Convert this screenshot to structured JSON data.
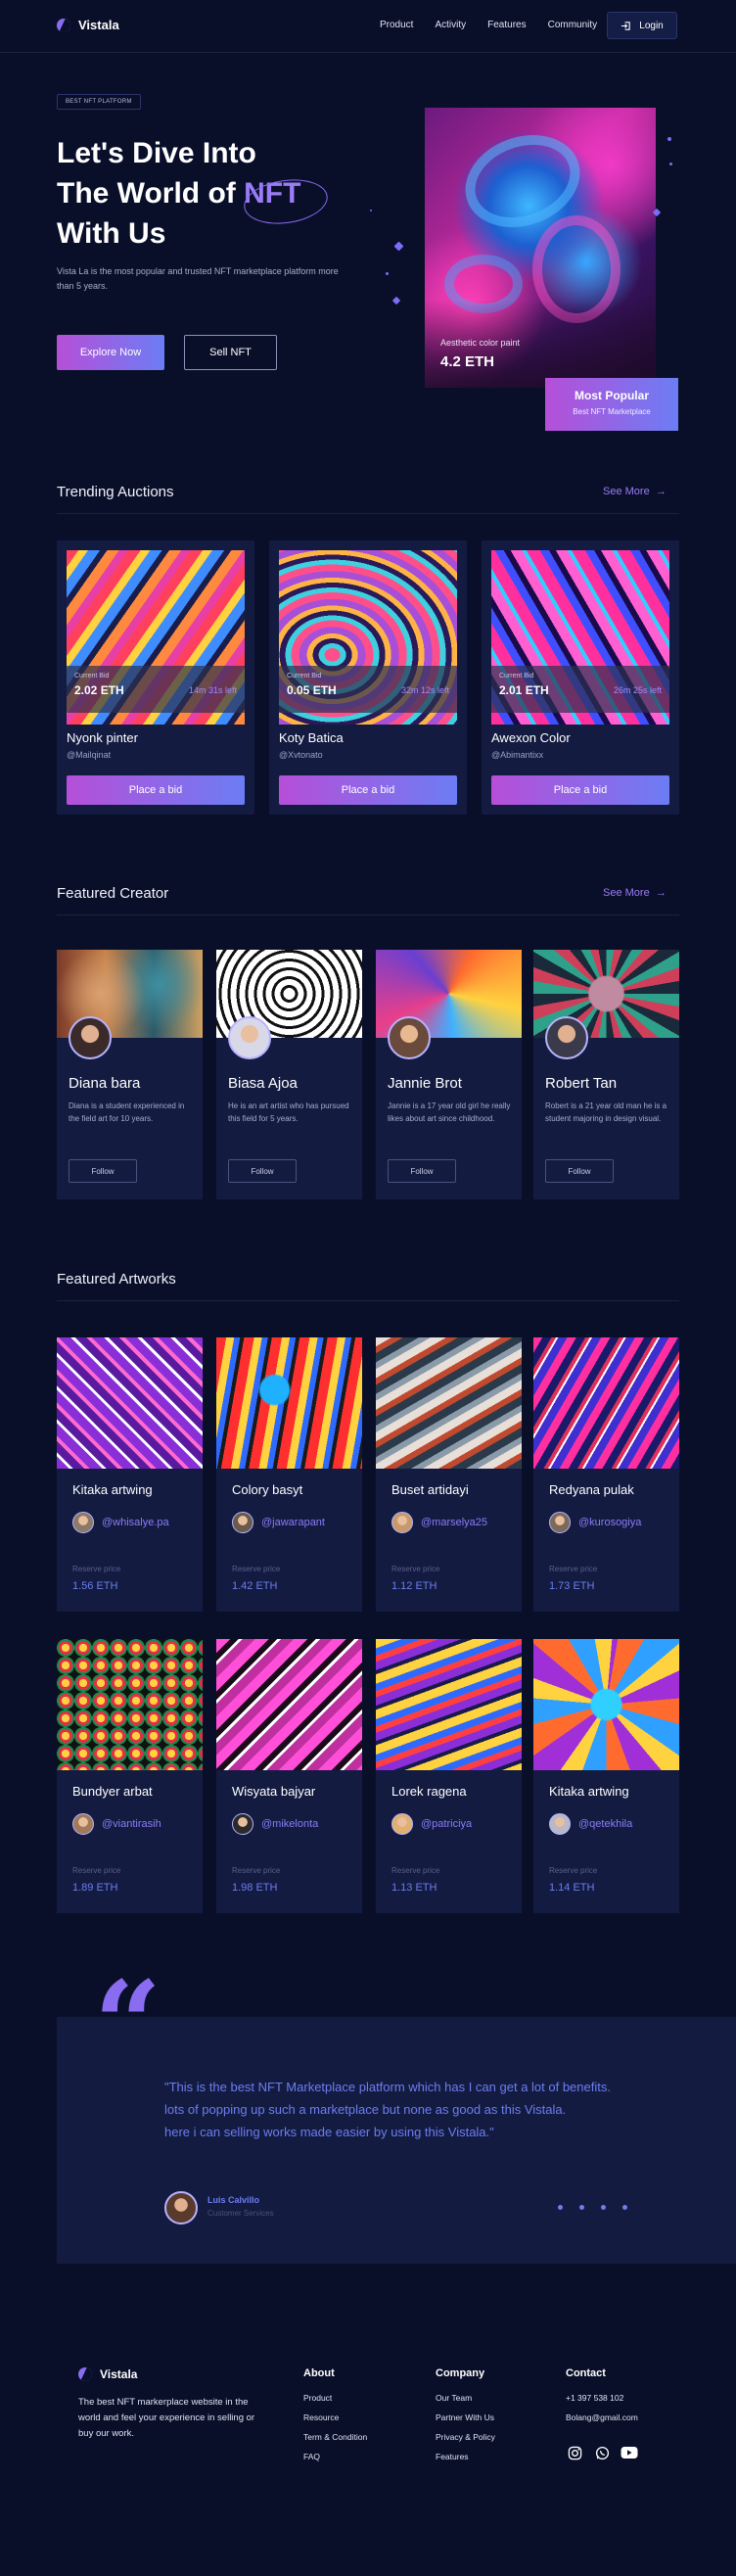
{
  "brand": {
    "name": "Vistala"
  },
  "nav": {
    "links": [
      "Product",
      "Activity",
      "Features",
      "Community"
    ],
    "login_label": "Login"
  },
  "hero": {
    "tag": "BEST NFT PLATFORM",
    "title_line1": "Let's Dive Into",
    "title_line2_pre": "The World of ",
    "title_highlight": "NFT",
    "title_line3": "With Us",
    "description": "Vista La is the most popular and trusted NFT marketplace platform more than 5 years.",
    "explore_label": "Explore Now",
    "sell_label": "Sell NFT",
    "art_label": "Aesthetic color paint",
    "art_price": "4.2 ETH",
    "popular_title": "Most Popular",
    "popular_sub": "Best NFT Marketplace"
  },
  "trending": {
    "title": "Trending Auctions",
    "see_more": "See More",
    "items": [
      {
        "bid_label": "Current Bid",
        "bid": "2.02 ETH",
        "time": "14m 31s left",
        "name": "Nyonk pinter",
        "user": "@Mailqinat",
        "button": "Place a bid"
      },
      {
        "bid_label": "Current Bid",
        "bid": "0.05 ETH",
        "time": "32m 12s left",
        "name": "Koty Batica",
        "user": "@Xvtonato",
        "button": "Place a bid"
      },
      {
        "bid_label": "Current Bid",
        "bid": "2.01 ETH",
        "time": "26m 25s left",
        "name": "Awexon Color",
        "user": "@Abimantixx",
        "button": "Place a bid"
      }
    ]
  },
  "creators": {
    "title": "Featured Creator",
    "see_more": "See More",
    "items": [
      {
        "name": "Diana bara",
        "bio": "Diana is a student experienced in the field art for 10 years.",
        "follow": "Follow"
      },
      {
        "name": "Biasa Ajoa",
        "bio": "He is an art artist who has pursued this field for 5 years.",
        "follow": "Follow"
      },
      {
        "name": "Jannie Brot",
        "bio": "Jannie is a 17 year old girl he really likes about art since childhood.",
        "follow": "Follow"
      },
      {
        "name": "Robert Tan",
        "bio": "Robert is a 21 year old man he is a student majoring in design visual.",
        "follow": "Follow"
      }
    ]
  },
  "artworks": {
    "title": "Featured Artworks",
    "items": [
      {
        "name": "Kitaka artwing",
        "user": "@whisalye.pa",
        "price_label": "Reserve price",
        "price": "1.56 ETH"
      },
      {
        "name": "Colory basyt",
        "user": "@jawarapant",
        "price_label": "Reserve price",
        "price": "1.42 ETH"
      },
      {
        "name": "Buset artidayi",
        "user": "@marselya25",
        "price_label": "Reserve price",
        "price": "1.12 ETH"
      },
      {
        "name": "Redyana pulak",
        "user": "@kurosogiya",
        "price_label": "Reserve price",
        "price": "1.73 ETH"
      },
      {
        "name": "Bundyer arbat",
        "user": "@viantirasih",
        "price_label": "Reserve price",
        "price": "1.89 ETH"
      },
      {
        "name": "Wisyata bajyar",
        "user": "@mikelonta",
        "price_label": "Reserve price",
        "price": "1.98 ETH"
      },
      {
        "name": "Lorek ragena",
        "user": "@patriciya",
        "price_label": "Reserve price",
        "price": "1.13 ETH"
      },
      {
        "name": "Kitaka artwing",
        "user": "@qetekhila",
        "price_label": "Reserve price",
        "price": "1.14 ETH"
      }
    ]
  },
  "testimonial": {
    "line1": "\"This is the best NFT Marketplace platform which has I can get a lot of benefits.",
    "line2": "lots of popping up such a marketplace but none as good as this Vistala.",
    "line3": "here i can selling works made easier by using this Vistala.\"",
    "name": "Luis Calvillo",
    "role": "Customer Services"
  },
  "footer": {
    "description": "The best NFT markerplace website in the world and feel your experience in selling or buy our work.",
    "about_title": "About",
    "about_links": [
      "Product",
      "Resource",
      "Term & Condition",
      "FAQ"
    ],
    "company_title": "Company",
    "company_links": [
      "Our Team",
      "Partner With Us",
      "Privacy & Policy",
      "Features"
    ],
    "contact_title": "Contact",
    "phone": "+1 397 538 102",
    "email": "Bolang@gmail.com",
    "social_icons": [
      "instagram-icon",
      "whatsapp-icon",
      "youtube-icon"
    ]
  },
  "colors": {
    "background": "#0a0f29",
    "card": "#131b41",
    "accent": "#8a6cf0",
    "gradient_start": "#b64fd8",
    "gradient_end": "#6c7df4"
  }
}
